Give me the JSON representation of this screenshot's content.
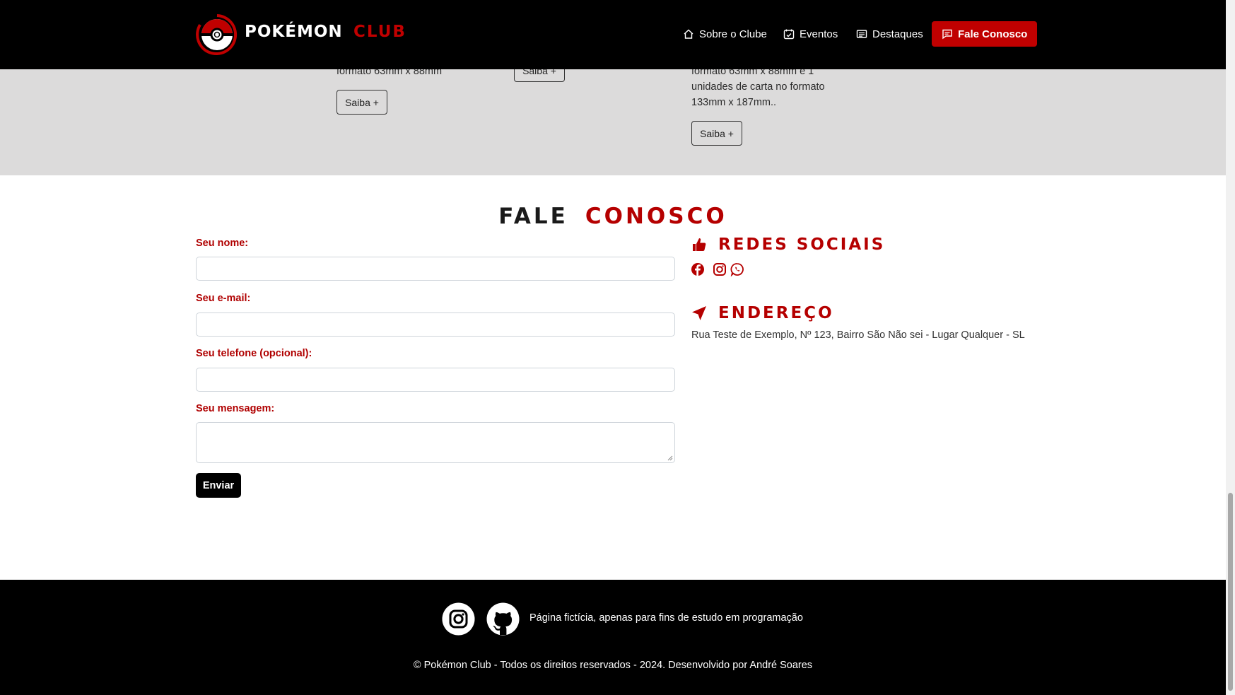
{
  "header": {
    "brand_primary": "POKÉMON",
    "brand_secondary": "CLUB",
    "nav": [
      "Sobre o Clube",
      "Eventos",
      "Destaques"
    ],
    "cta": "Fale Conosco"
  },
  "cards": {
    "card1_text": "formato 63mm x 88mm",
    "card3_lines": [
      "formato 63mm x 88mm e 1",
      "unidades de carta no formato",
      "133mm x 187mm.."
    ],
    "saiba_label": "Saiba +"
  },
  "contact": {
    "title_part1": "FALE",
    "title_part2": "CONOSCO",
    "fields": {
      "name": "Seu nome:",
      "email": "Seu e-mail:",
      "phone": "Seu telefone (opcional):",
      "message": "Seu mensagem:"
    },
    "send_label": "Enviar"
  },
  "side": {
    "social_title": "REDES SOCIAIS",
    "address_title": "ENDEREÇO",
    "address": "Rua Teste de Exemplo, Nº 123, Bairro São Não sei - Lugar Qualquer - SL",
    "icons": [
      "facebook-icon",
      "instagram-icon",
      "whatsapp-icon"
    ]
  },
  "footer": {
    "note": "Página fictícia, apenas para fins de estudo em programação",
    "copyright": "© Pokémon Club - Todos os direitos reservados - 2024. Desenvolvido por André Soares"
  },
  "colors": {
    "accent": "#c00000",
    "band": "#dcdbdb",
    "header": "#000000"
  }
}
